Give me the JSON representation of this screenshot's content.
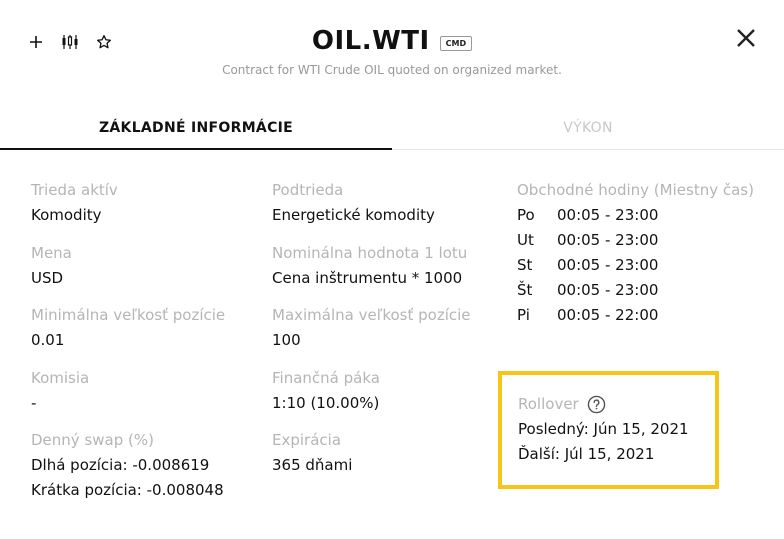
{
  "header": {
    "title": "OIL.WTI",
    "badge": "CMD",
    "subtitle": "Contract for WTI Crude OIL quoted on organized market.",
    "icons": [
      "plus-icon",
      "candlestick-chart-icon",
      "star-icon",
      "close-icon"
    ]
  },
  "tabs": [
    {
      "label": "ZÁKLADNÉ INFORMÁCIE",
      "active": true
    },
    {
      "label": "VÝKON",
      "active": false
    }
  ],
  "col1": {
    "asset_class_label": "Trieda aktív",
    "asset_class_value": "Komodity",
    "currency_label": "Mena",
    "currency_value": "USD",
    "min_size_label": "Minimálna veľkosť pozície",
    "min_size_value": "0.01",
    "commission_label": "Komisia",
    "commission_value": "-",
    "swap_label": "Denný swap (%)",
    "swap_long": "Dlhá pozícia: -0.008619",
    "swap_short": "Krátka pozícia: -0.008048"
  },
  "col2": {
    "subclass_label": "Podtrieda",
    "subclass_value": "Energetické komodity",
    "nominal_label": "Nominálna hodnota 1 lotu",
    "nominal_value": "Cena inštrumentu * 1000",
    "max_size_label": "Maximálna veľkosť pozície",
    "max_size_value": "100",
    "leverage_label": "Finančná páka",
    "leverage_value": "1:10 (10.00%)",
    "expiry_label": "Expirácia",
    "expiry_value": "365 dňami"
  },
  "hours": {
    "label": "Obchodné hodiny (Miestny čas)",
    "rows": [
      {
        "day": "Po",
        "time": "00:05 - 23:00"
      },
      {
        "day": "Ut",
        "time": "00:05 - 23:00"
      },
      {
        "day": "St",
        "time": "00:05 - 23:00"
      },
      {
        "day": "Št",
        "time": "00:05 - 23:00"
      },
      {
        "day": "Pi",
        "time": "00:05 - 22:00"
      }
    ]
  },
  "rollover": {
    "label": "Rollover",
    "last": "Posledný: Jún 15, 2021",
    "next": "Ďalší: Júl 15, 2021",
    "highlight_color": "#f5c518"
  }
}
